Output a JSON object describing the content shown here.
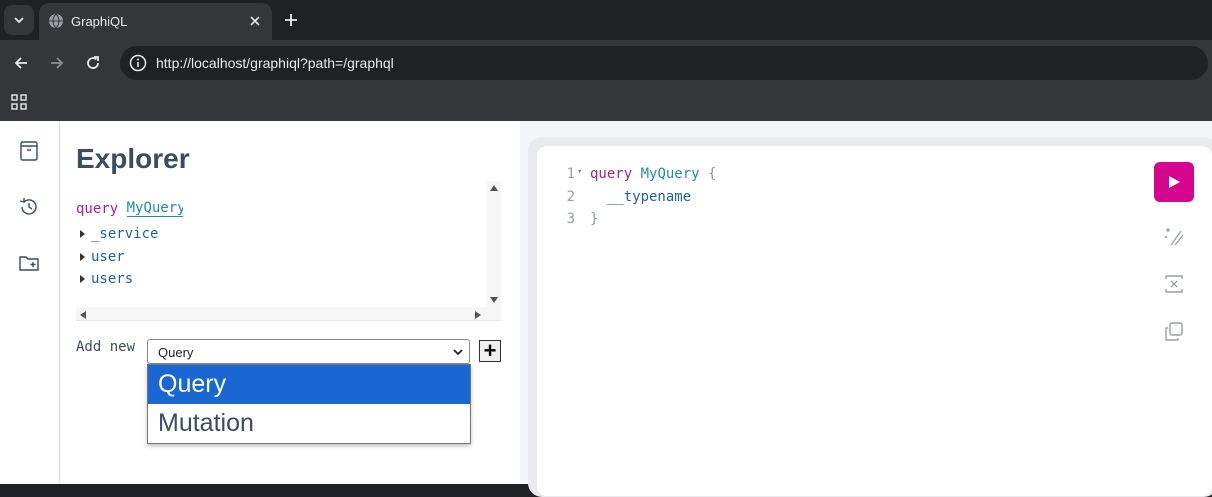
{
  "browser": {
    "tab_title": "GraphiQL",
    "url": "http://localhost/graphiql?path=/graphql"
  },
  "explorer": {
    "title": "Explorer",
    "operation_keyword": "query",
    "operation_name": "MyQuery",
    "fields": [
      "_service",
      "user",
      "users"
    ],
    "add_new_label": "Add new",
    "add_new_selected": "Query",
    "add_new_button": "+",
    "dropdown_options": [
      "Query",
      "Mutation"
    ],
    "dropdown_highlighted": "Query"
  },
  "editor": {
    "lines": [
      {
        "num": "1",
        "keyword": "query",
        "name": "MyQuery",
        "punct": "{"
      },
      {
        "num": "2",
        "field": "__typename"
      },
      {
        "num": "3",
        "punct": "}"
      }
    ]
  },
  "colors": {
    "accent": "#d60590",
    "selected_option": "#1a66d2"
  }
}
